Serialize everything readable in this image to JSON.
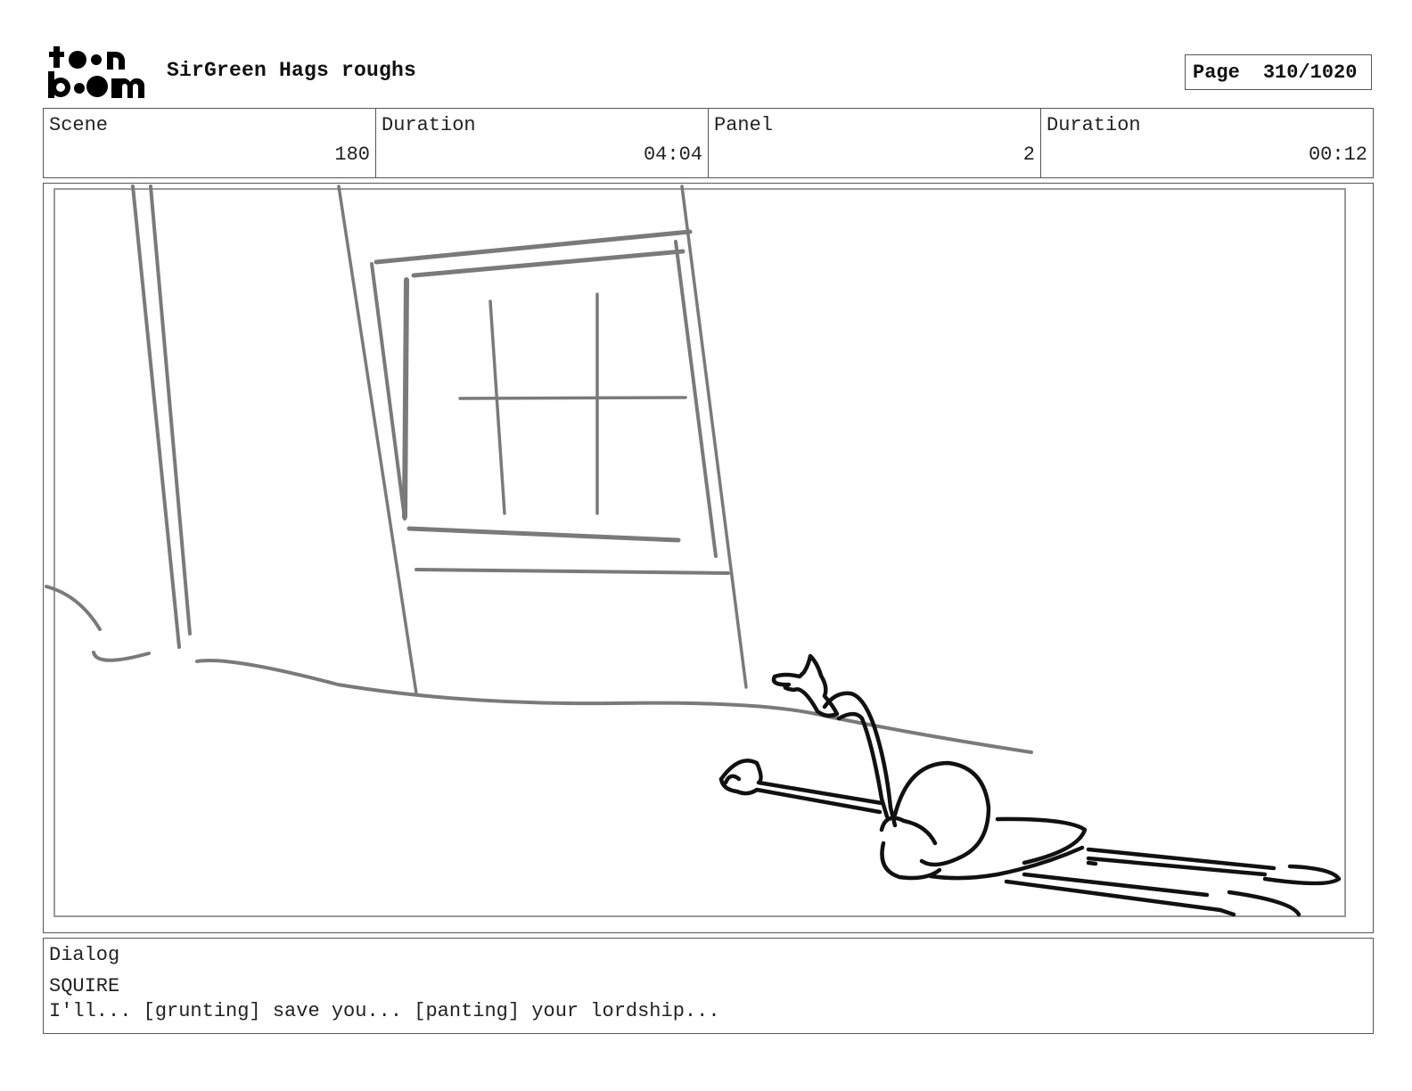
{
  "logo": {
    "line1": "toon",
    "line2": "boom"
  },
  "header": {
    "project_title": "SirGreen Hags roughs",
    "page_label": "Page",
    "page_number": "310/1020"
  },
  "info": {
    "scene_label": "Scene",
    "scene_value": "180",
    "scene_duration_label": "Duration",
    "scene_duration_value": "04:04",
    "panel_label": "Panel",
    "panel_value": "2",
    "panel_duration_label": "Duration",
    "panel_duration_value": "00:12"
  },
  "dialog": {
    "label": "Dialog",
    "speaker": "SQUIRE",
    "line": "I'll... [grunting] save you... [panting] your lordship..."
  },
  "colors": {
    "sketch_gray": "#7a7a7a",
    "sketch_black": "#111111",
    "border": "#555555"
  }
}
